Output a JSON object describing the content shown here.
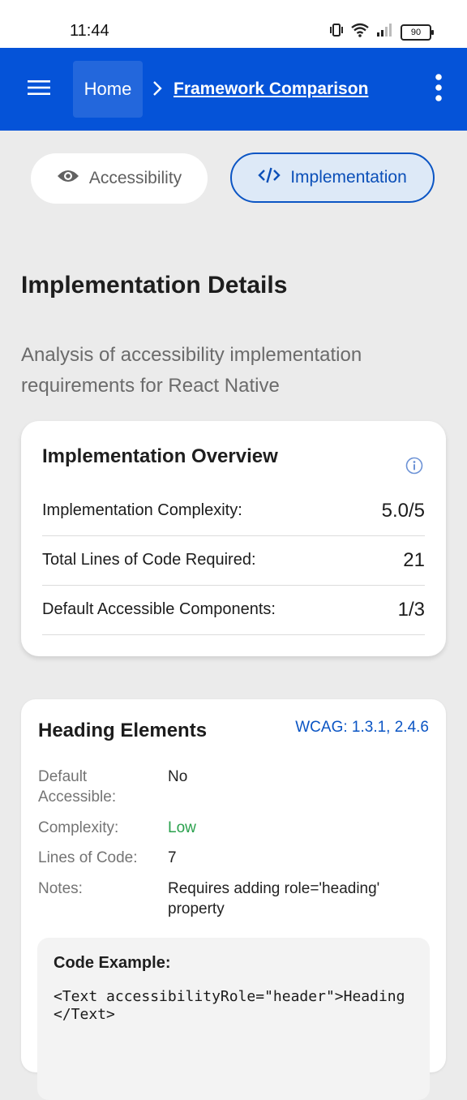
{
  "status_bar": {
    "time": "11:44",
    "battery": "90",
    "icons": [
      "vibrate-icon",
      "wifi-icon",
      "signal-icon",
      "battery-icon"
    ]
  },
  "app_bar": {
    "breadcrumb": {
      "home": "Home",
      "current": "Framework Comparison"
    },
    "icons": [
      "menu-icon",
      "chevron-right-icon",
      "more-vertical-icon"
    ],
    "background": "#0553d8"
  },
  "tabs": [
    {
      "label": "Accessibility",
      "icon": "eye-icon",
      "selected": false
    },
    {
      "label": "Implementation",
      "icon": "code-icon",
      "selected": true
    }
  ],
  "page": {
    "title": "Implementation Details",
    "subtitle": "Analysis of accessibility implementation requirements for React Native"
  },
  "overview": {
    "title": "Implementation Overview",
    "info_icon": "info-icon",
    "stats": [
      {
        "label": "Implementation Complexity:",
        "value": "5.0/5"
      },
      {
        "label": "Total Lines of Code Required:",
        "value": "21"
      },
      {
        "label": "Default Accessible Components:",
        "value": "1/3"
      }
    ]
  },
  "heading_card": {
    "title": "Heading Elements",
    "wcag": "WCAG: 1.3.1, 2.4.6",
    "details": {
      "default_accessible_label": "Default Accessible:",
      "default_accessible_value": "No",
      "complexity_label": "Complexity:",
      "complexity_value": "Low",
      "lines_label": "Lines of Code:",
      "lines_value": "7",
      "notes_label": "Notes:",
      "notes_value": "Requires adding role='heading' property"
    },
    "code_title": "Code Example:",
    "code": "<Text accessibilityRole=\"header\">Heading</Text>"
  },
  "colors": {
    "accent": "#0b55c4",
    "low_complexity": "#2aa14d"
  }
}
